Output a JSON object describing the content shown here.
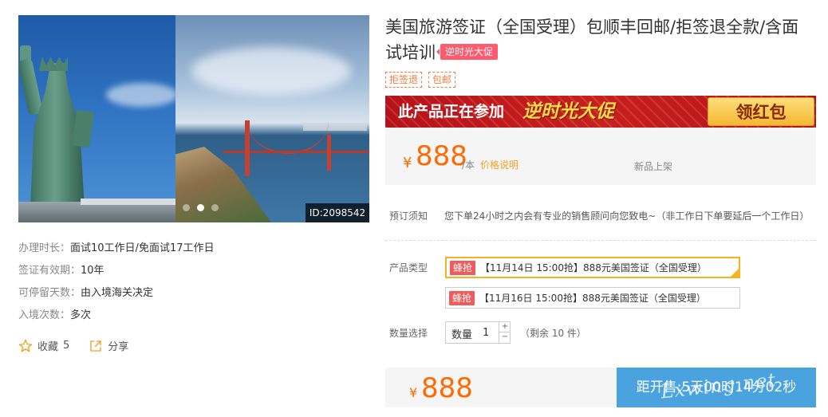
{
  "gallery": {
    "id_label": "ID:2098542",
    "dots": 3,
    "active_dot": 2
  },
  "info": [
    {
      "key": "办理时长：",
      "value": "面试10工作日/免面试17工作日"
    },
    {
      "key": "签证有效期：",
      "value": "10年"
    },
    {
      "key": "可停留天数：",
      "value": "由入境海关决定"
    },
    {
      "key": "入境次数：",
      "value": "多次"
    }
  ],
  "actions": {
    "favorite_label": "收藏",
    "favorite_count": "5",
    "share_label": "分享"
  },
  "product": {
    "title": "美国旅游签证（全国受理）包顺丰回邮/拒签退全款/含面试培训",
    "promo_tag": "逆时光大促",
    "tags": [
      "拒签退",
      "包邮"
    ]
  },
  "banner": {
    "left_text": "此产品正在参加",
    "promo_name": "逆时光大促",
    "button_label": "领红包"
  },
  "price": {
    "currency": "¥",
    "value": "888",
    "unit": "/本",
    "explain": "价格说明",
    "new_flag": "新品上架"
  },
  "notice": {
    "label": "预订须知",
    "text": "您下单24小时之内会有专业的销售顾问向您致电~（非工作日下单要延后一个工作日）"
  },
  "product_type": {
    "label": "产品类型",
    "options": [
      {
        "badge": "蜂抢",
        "text": "【11月14日 15:00抢】888元美国签证（全国受理）",
        "selected": true
      },
      {
        "badge": "蜂抢",
        "text": "【11月16日 15:00抢】888元美国签证（全国受理）",
        "selected": false
      }
    ]
  },
  "quantity": {
    "label": "数量选择",
    "box_label": "数量",
    "value": "1",
    "plus": "+",
    "minus": "−",
    "stock_text": "（剩余 10 件）"
  },
  "bottom": {
    "currency": "¥",
    "price": "888",
    "countdown_label": "距开售:5天00时14分02秒",
    "watermark": "Lxwing.net"
  },
  "colors": {
    "accent_orange": "#ff6a00",
    "promo_red": "#ff5a6e",
    "button_blue": "#4aa3df",
    "selected_border": "#f6b024"
  }
}
